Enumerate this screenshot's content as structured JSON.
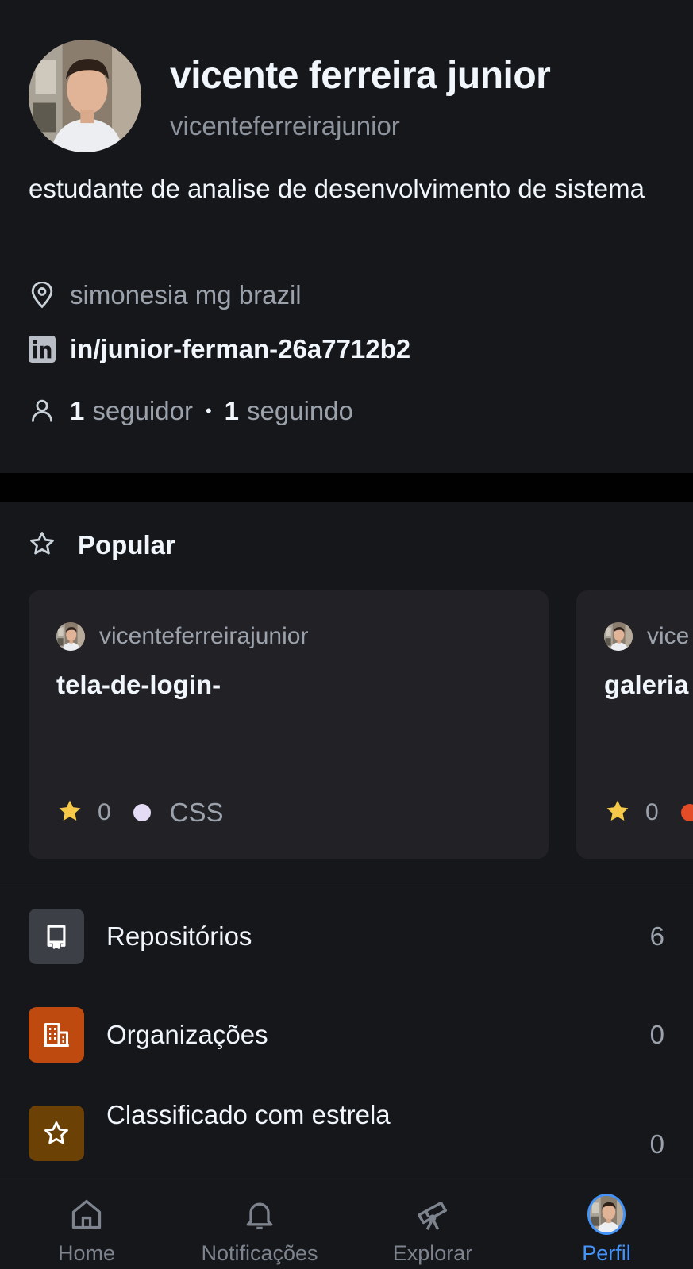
{
  "profile": {
    "display_name": "vicente ferreira junior",
    "username": "vicenteferreirajunior",
    "bio": "estudante de analise de desenvolvimento de sistema",
    "location": "simonesia mg brazil",
    "linkedin": "in/junior-ferman-26a7712b2",
    "followers_count": "1",
    "followers_label": "seguidor",
    "separator": "•",
    "following_count": "1",
    "following_label": "seguindo",
    "icons": {
      "location": "map-pin-icon",
      "linkedin": "linkedin-icon",
      "people": "person-icon"
    }
  },
  "popular": {
    "title": "Popular",
    "icon": "star-outline-icon",
    "cards": [
      {
        "owner": "vicenteferreirajunior",
        "name": "tela-de-login-",
        "stars": "0",
        "language": "CSS",
        "language_color": "#e4dcf5"
      },
      {
        "owner": "vice",
        "name": "galeria",
        "stars": "0",
        "language": "",
        "language_color": "#e34c26"
      }
    ]
  },
  "menu": [
    {
      "label": "Repositórios",
      "count": "6",
      "icon": "repo-icon",
      "color": "#3d3f47"
    },
    {
      "label": "Organizações",
      "count": "0",
      "icon": "organization-icon",
      "color": "#bf4a0f"
    },
    {
      "label": "Classificado com estrela",
      "count": "0",
      "icon": "star-icon",
      "color": "#6b4106"
    }
  ],
  "bottom_nav": [
    {
      "label": "Home",
      "icon": "home-icon",
      "active": false
    },
    {
      "label": "Notificações",
      "icon": "bell-icon",
      "active": false
    },
    {
      "label": "Explorar",
      "icon": "telescope-icon",
      "active": false
    },
    {
      "label": "Perfil",
      "icon": "avatar",
      "active": true
    }
  ],
  "colors": {
    "background": "#16171b",
    "card": "#212126",
    "accent": "#4493f8",
    "star": "#f7c948"
  }
}
